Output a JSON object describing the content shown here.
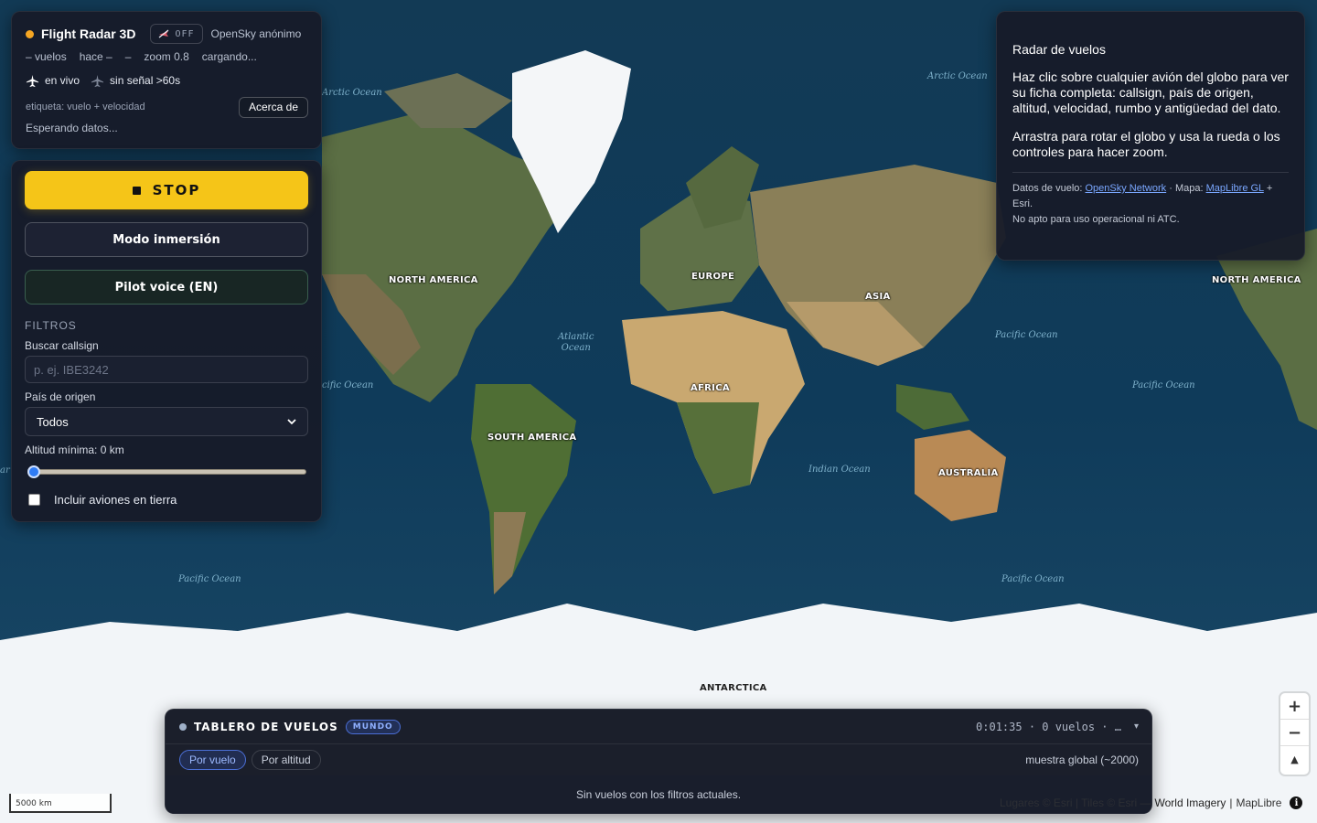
{
  "map": {
    "continents": {
      "north_america": "NORTH AMERICA",
      "north_america_2": "NORTH AMERICA",
      "europe": "EUROPE",
      "asia": "ASIA",
      "africa": "AFRICA",
      "south_america": "SOUTH AMERICA",
      "australia": "AUSTRALIA",
      "antarctica": "ANTARCTICA"
    },
    "oceans": {
      "arctic_left": "Arctic Ocean",
      "arctic_right": "Arctic Ocean",
      "atlantic_1": "Atlantic",
      "atlantic_2": "Ocean",
      "pacific_right_top": "Pacific Ocean",
      "pacific_far_right": "Pacific Ocean",
      "pacific_left_mid": "cific Ocean",
      "indian": "Indian Ocean",
      "pacific_bottom_left": "Pacific Ocean",
      "pacific_bottom_right": "Pacific Ocean"
    },
    "edge_fragment": "ar",
    "scale_label": "5000 km",
    "attribution": {
      "faint": "Lugares © Esri | Tiles © Esri —",
      "imagery": "World Imagery",
      "separator": "|",
      "maplibre": "MapLibre"
    },
    "zoom_in": "+",
    "zoom_out": "−",
    "compass": "▲"
  },
  "status": {
    "title": "Flight Radar 3D",
    "off_label": "OFF",
    "source": "OpenSky anónimo",
    "stats": {
      "flights": "– vuelos",
      "age": "hace –",
      "dash": "–",
      "zoom": "zoom 0.8",
      "loading": "cargando..."
    },
    "legend": {
      "live": "en vivo",
      "no_signal": "sin señal >60s"
    },
    "label_mode": "etiqueta: vuelo + velocidad",
    "about_button": "Acerca de",
    "waiting": "Esperando datos..."
  },
  "controls": {
    "stop_button": "STOP",
    "immersion_button": "Modo inmersión",
    "pilot_voice_button": "Pilot voice (EN)",
    "filters_title": "FILTROS",
    "callsign_label": "Buscar callsign",
    "callsign_placeholder": "p. ej. IBE3242",
    "callsign_value": "",
    "country_label": "País de origen",
    "country_selected": "Todos",
    "altitude_label": "Altitud mínima: 0 km",
    "altitude_value_fraction": 0,
    "ground_checkbox_label": "Incluir aviones en tierra",
    "ground_checkbox_checked": false
  },
  "info": {
    "title": "Radar de vuelos",
    "paragraph1": "Haz clic sobre cualquier avión del globo para ver su ficha completa: callsign, país de origen, altitud, velocidad, rumbo y antigüedad del dato.",
    "paragraph2": "Arrastra para rotar el globo y usa la rueda o los controles para hacer zoom.",
    "credits_prefix": "Datos de vuelo:",
    "opensky_link": "OpenSky Network",
    "credits_mid": "· Mapa:",
    "maplibre_link": "MapLibre GL",
    "credits_suffix": "+ Esri.",
    "disclaimer": "No apto para uso operacional ni ATC."
  },
  "board": {
    "title": "TABLERO DE VUELOS",
    "scope_badge": "MUNDO",
    "meta": "0:01:35 · 0 vuelos · …",
    "collapse": "▾",
    "tabs": [
      "Por vuelo",
      "Por altitud"
    ],
    "sample_label": "muestra global (~2000)",
    "empty_message": "Sin vuelos con los filtros actuales."
  },
  "colors": {
    "accent_yellow": "#f5c518",
    "status_dot": "#f5a623",
    "badge_blue": "#4b6fd6",
    "link_blue": "#7aa7ff"
  }
}
